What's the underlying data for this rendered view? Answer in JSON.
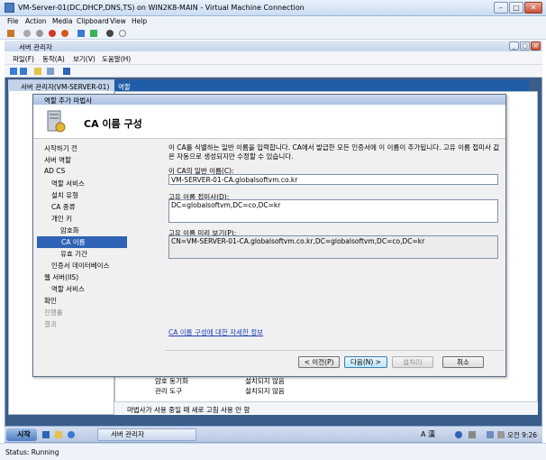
{
  "vm_window": {
    "title": "VM-Server-01(DC,DHCP,DNS,TS) on WIN2K8-MAIN - Virtual Machine Connection",
    "menu": [
      "File",
      "Action",
      "Media",
      "Clipboard",
      "View",
      "Help"
    ],
    "status": "Status: Running"
  },
  "server_manager": {
    "title": "서버 관리자",
    "menu": [
      "파일(F)",
      "동작(A)",
      "보기(V)",
      "도움말(H)"
    ],
    "tree_root": "서버 관리자(VM-SERVER-01)",
    "right_header": "역할",
    "bottom_rows": [
      {
        "name": "암호 동기화",
        "status": "설치되지 않음"
      },
      {
        "name": "관리 도구",
        "status": "설치되지 않음"
      }
    ],
    "status_text": "마법사가 사용 중일 때 새로 고침 사용 안 함"
  },
  "wizard": {
    "title": "역할 추가 마법사",
    "heading": "CA 이름 구성",
    "nav": [
      {
        "label": "시작하기 전",
        "indent": 0,
        "state": "normal"
      },
      {
        "label": "서버 역할",
        "indent": 0,
        "state": "normal"
      },
      {
        "label": "AD CS",
        "indent": 0,
        "state": "normal"
      },
      {
        "label": "역할 서비스",
        "indent": 1,
        "state": "normal"
      },
      {
        "label": "설치 유형",
        "indent": 1,
        "state": "normal"
      },
      {
        "label": "CA 종류",
        "indent": 1,
        "state": "normal"
      },
      {
        "label": "개인 키",
        "indent": 1,
        "state": "normal"
      },
      {
        "label": "암호화",
        "indent": 2,
        "state": "normal"
      },
      {
        "label": "CA 이름",
        "indent": 2,
        "state": "selected"
      },
      {
        "label": "유효 기간",
        "indent": 2,
        "state": "normal"
      },
      {
        "label": "인증서 데이터베이스",
        "indent": 1,
        "state": "normal"
      },
      {
        "label": "웹 서버(IIS)",
        "indent": 0,
        "state": "normal"
      },
      {
        "label": "역할 서비스",
        "indent": 1,
        "state": "normal"
      },
      {
        "label": "확인",
        "indent": 0,
        "state": "normal"
      },
      {
        "label": "진행률",
        "indent": 0,
        "state": "disabled"
      },
      {
        "label": "결과",
        "indent": 0,
        "state": "disabled"
      }
    ],
    "description": "이 CA를 식별하는 일반 이름을 입력합니다. CA에서 발급한 모든 인증서에 이 이름이 추가됩니다. 고유 이름 접미사 값은 자동으로 생성되지만 수정할 수 있습니다.",
    "common_name_label": "이 CA의 일반 이름(C):",
    "common_name_value": "VM-SERVER-01-CA.globalsoftvm.co.kr",
    "suffix_label": "고유 이름 접미사(D):",
    "suffix_value": "DC=globalsoftvm,DC=co,DC=kr",
    "preview_label": "고유 이름 미리 보기(P):",
    "preview_value": "CN=VM-SERVER-01-CA.globalsoftvm.co.kr,DC=globalsoftvm,DC=co,DC=kr",
    "more_info_link": "CA 이름 구성에 대한 자세한 정보",
    "buttons": {
      "prev": "< 이전(P)",
      "next": "다음(N) >",
      "install": "설치(I)",
      "cancel": "취소"
    }
  },
  "taskbar": {
    "start": "시작",
    "task": "서버 관리자",
    "lang": "A 漢",
    "time": "오전 9:26"
  }
}
